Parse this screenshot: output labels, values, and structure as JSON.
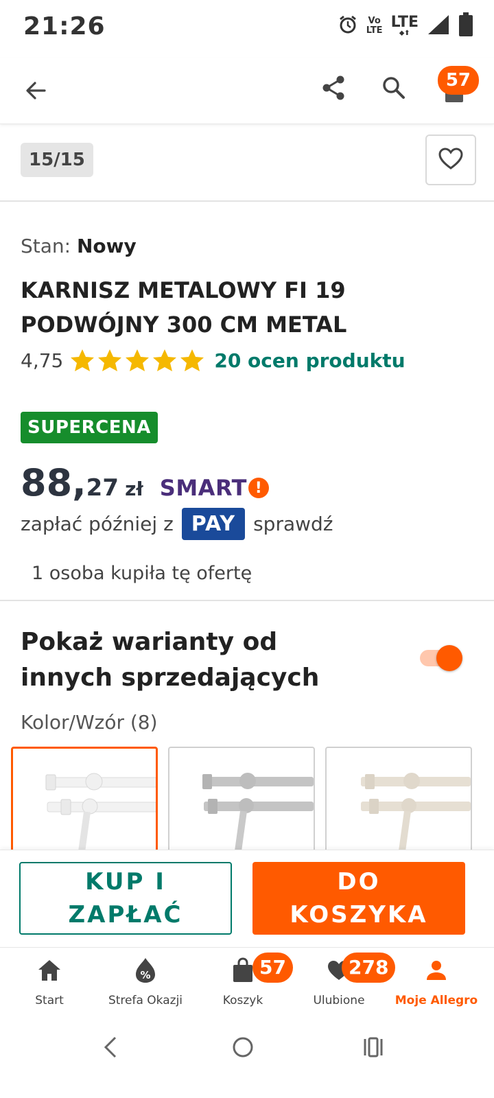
{
  "status_bar": {
    "time": "21:26",
    "volte_top": "Vo",
    "volte_bottom": "LTE",
    "network": "LTE"
  },
  "app_bar": {
    "cart_count": "57",
    "icons": [
      "back-arrow-icon",
      "share-icon",
      "search-icon",
      "cart-icon"
    ]
  },
  "gallery": {
    "counter": "15/15"
  },
  "product": {
    "condition_label": "Stan:",
    "condition_value": "Nowy",
    "title": "KARNISZ METALOWY FI 19 PODWÓJNY 300 CM METAL",
    "rating_value": "4,75",
    "rating_stars": 5,
    "rating_link": "20 ocen produktu",
    "badge": "SUPERCENA",
    "price_int": "88,",
    "price_dec": "27",
    "currency": "zł",
    "smart_label": "SMART",
    "smart_mark": "!",
    "pay_prefix": "zapłać później z",
    "pay_logo": "PAY",
    "pay_suffix": "sprawdź",
    "buyers": "1 osoba kupiła tę ofertę"
  },
  "variants": {
    "title": "Pokaż warianty od innych sprzedających",
    "toggle_on": true,
    "label": "Kolor/Wzór (8)",
    "thumbnails": [
      {
        "name": "white",
        "color": "#f4f4f4",
        "selected": true
      },
      {
        "name": "graphite",
        "color": "#b5b5b5",
        "selected": false
      },
      {
        "name": "beige",
        "color": "#e2dcd2",
        "selected": false
      }
    ]
  },
  "actions": {
    "buy_now": "KUP I ZAPŁAĆ",
    "add_to_cart": "DO KOSZYKA"
  },
  "bottom_nav": {
    "items": [
      {
        "label": "Start",
        "icon": "home-icon"
      },
      {
        "label": "Strefa Okazji",
        "icon": "deals-icon"
      },
      {
        "label": "Koszyk",
        "icon": "cart-icon",
        "badge": "57"
      },
      {
        "label": "Ulubione",
        "icon": "heart-icon",
        "badge": "278"
      },
      {
        "label": "Moje Allegro",
        "icon": "person-icon",
        "active": true
      }
    ]
  },
  "colors": {
    "accent": "#ff5a00",
    "teal": "#007a6a",
    "super_green": "#168d2c",
    "pay_blue": "#1a4a9a",
    "smart_purple": "#4a2e7a"
  }
}
